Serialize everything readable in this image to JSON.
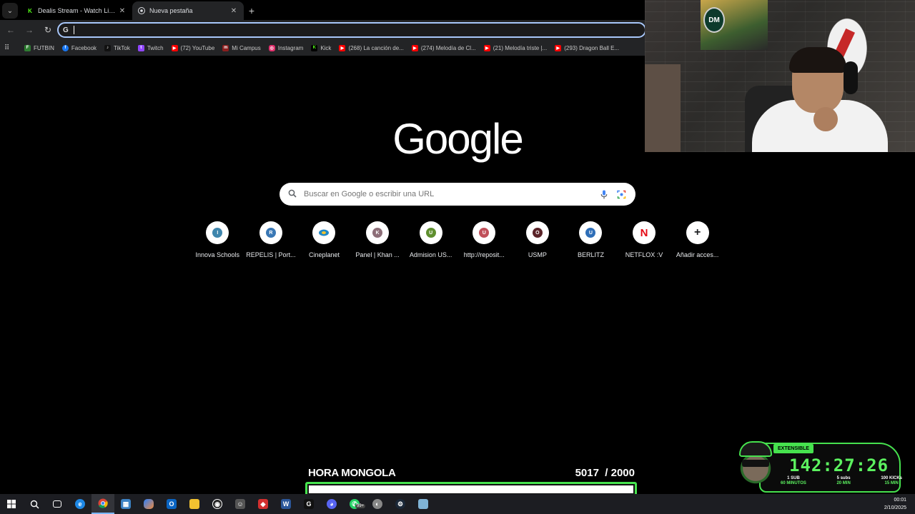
{
  "browser": {
    "tabs": [
      {
        "title": "Dealis Stream - Watch Live on Kick",
        "icon": "kick-icon",
        "active": false,
        "favicon_color": "#53fc18"
      },
      {
        "title": "Nueva pestaña",
        "icon": "chrome-icon",
        "active": true,
        "favicon_color": "#dadce0"
      }
    ],
    "omnibox_value": ""
  },
  "bookmarks": [
    {
      "label": "FUTBIN",
      "icon": "futbin-icon",
      "color": "#2e7d32"
    },
    {
      "label": "Facebook",
      "icon": "facebook-icon",
      "color": "#1877f2"
    },
    {
      "label": "TikTok",
      "icon": "tiktok-icon",
      "color": "#111111"
    },
    {
      "label": "Twitch",
      "icon": "twitch-icon",
      "color": "#9146ff"
    },
    {
      "label": "(72) YouTube",
      "icon": "youtube-icon",
      "color": "#ff0000"
    },
    {
      "label": "Mi Campus",
      "icon": "campus-icon",
      "color": "#8b1e1e"
    },
    {
      "label": "Instagram",
      "icon": "instagram-icon",
      "color": "#e1306c"
    },
    {
      "label": "Kick",
      "icon": "kick-icon",
      "color": "#53fc18"
    },
    {
      "label": "(268) La canción de...",
      "icon": "youtube-icon",
      "color": "#ff0000"
    },
    {
      "label": "(274) Melodía de Cl...",
      "icon": "youtube-icon",
      "color": "#ff0000"
    },
    {
      "label": "(21) Melodía triste |...",
      "icon": "youtube-icon",
      "color": "#ff0000"
    },
    {
      "label": "(293) Dragon Ball E...",
      "icon": "youtube-icon",
      "color": "#ff0000"
    }
  ],
  "ntp": {
    "logo": "Google",
    "search_placeholder": "Buscar en Google o escribir una URL",
    "shortcuts": [
      {
        "label": "Innova Schools",
        "letter": "I",
        "color": "#3f86ad"
      },
      {
        "label": "REPELIS | Port...",
        "letter": "R",
        "color": "#3a78b5"
      },
      {
        "label": "Cineplanet",
        "letter": "",
        "color": "#1e88c8"
      },
      {
        "label": "Panel | Khan ...",
        "letter": "K",
        "color": "#8d6e78"
      },
      {
        "label": "Admision US...",
        "letter": "U",
        "color": "#5f8f2f"
      },
      {
        "label": "http://reposit...",
        "letter": "U",
        "color": "#c0505a"
      },
      {
        "label": "USMP",
        "letter": "O",
        "color": "#5a2328"
      },
      {
        "label": "BERLITZ",
        "letter": "U",
        "color": "#2f6fb8"
      },
      {
        "label": "NETFLOX :V",
        "letter": "N",
        "color": "#e50914"
      },
      {
        "label": "Añadir acces...",
        "letter": "+",
        "color": "#ffffff"
      }
    ]
  },
  "overlay": {
    "goal_label": "HORA MONGOLA",
    "goal_current": "5017",
    "goal_target": "/ 2000",
    "goal_fill_fraction": 1.0,
    "timer_badge": "EXTENSIBLE",
    "timer_value": "142:27:26",
    "rules": [
      {
        "top": "1 SUB",
        "bottom": "60 MINUTOS"
      },
      {
        "top": "5 subs",
        "bottom": "20 MIN"
      },
      {
        "top": "100 KICKs",
        "bottom": "15 MIN"
      }
    ]
  },
  "taskbar": {
    "time": "00:01",
    "date": "2/10/2025",
    "whatsapp_badge": "99+",
    "apps": [
      "windows-icon",
      "search-icon",
      "task-view-icon",
      "edge-icon",
      "chrome-icon",
      "store-icon",
      "copilot-icon",
      "outlook-icon",
      "explorer-icon",
      "obs-icon",
      "game-icon",
      "app-red-icon",
      "word-icon",
      "kick-app-icon",
      "discord-icon",
      "whatsapp-icon",
      "game2-icon",
      "steam-icon",
      "notes-icon"
    ]
  }
}
